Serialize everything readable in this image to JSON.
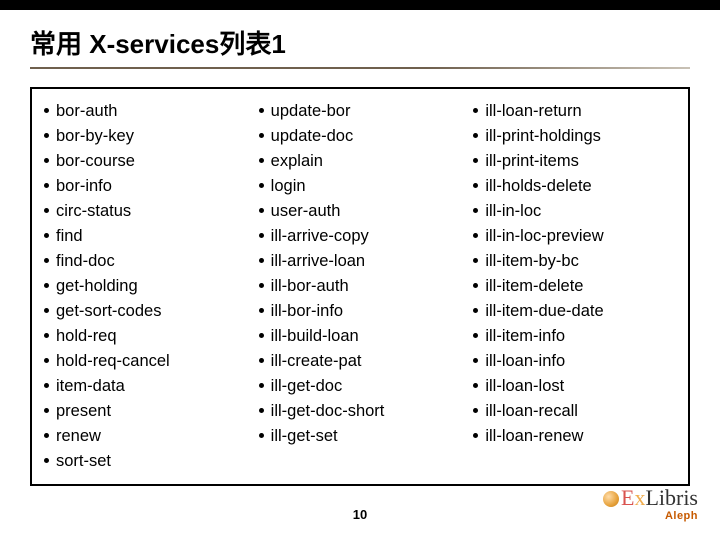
{
  "title": "常用 X-services列表1",
  "columns": [
    [
      "bor-auth",
      "bor-by-key",
      "bor-course",
      "bor-info",
      "circ-status",
      "find",
      "find-doc",
      "get-holding",
      "get-sort-codes",
      "hold-req",
      "hold-req-cancel",
      "item-data",
      "present",
      "renew",
      "sort-set"
    ],
    [
      "update-bor",
      "update-doc",
      "explain",
      "login",
      "user-auth",
      "ill-arrive-copy",
      "ill-arrive-loan",
      "ill-bor-auth",
      "ill-bor-info",
      "ill-build-loan",
      "ill-create-pat",
      "ill-get-doc",
      "ill-get-doc-short",
      "ill-get-set"
    ],
    [
      "ill-loan-return",
      "ill-print-holdings",
      "ill-print-items",
      "ill-holds-delete",
      "ill-in-loc",
      "ill-in-loc-preview",
      "ill-item-by-bc",
      "ill-item-delete",
      "ill-item-due-date",
      "ill-item-info",
      "ill-loan-info",
      "ill-loan-lost",
      "ill-loan-recall",
      "ill-loan-renew"
    ]
  ],
  "page_number": "10",
  "logo": {
    "brand_e": "E",
    "brand_x": "x",
    "brand_rest": "Libris",
    "sub": "Aleph"
  }
}
